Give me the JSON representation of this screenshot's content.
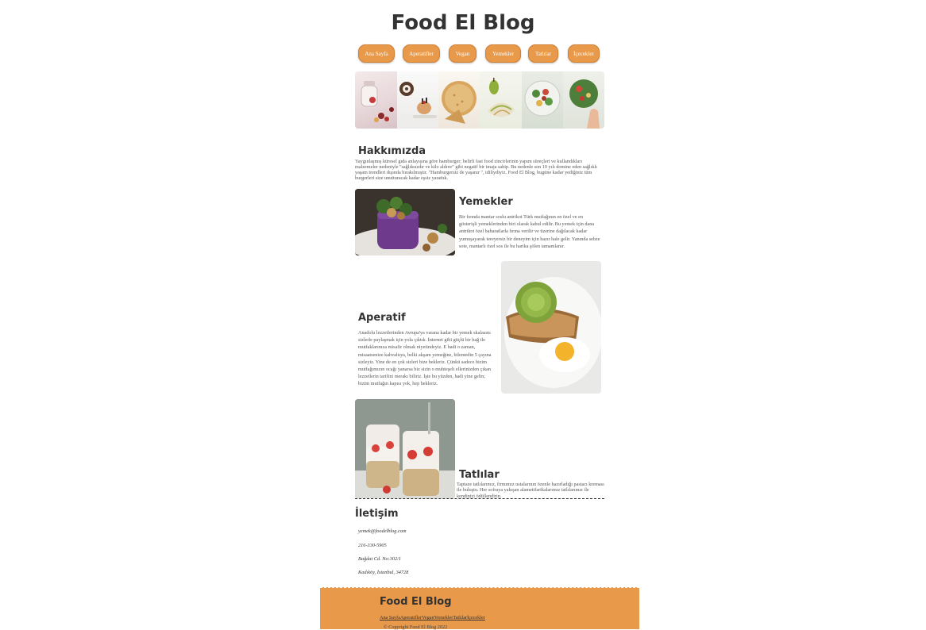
{
  "site": {
    "title": "Food El Blog"
  },
  "nav": {
    "items": [
      "Ana Sayfa",
      "Aperatifler",
      "Vegan",
      "Yemekler",
      "Tatlılar",
      "İçecekler"
    ]
  },
  "about": {
    "heading": "Hakkımızda",
    "text": "Yaygınlaşmış küresel gıda anlayışına göre hamburger; belirli fast food zincirlerinin yapım süreçleri ve kullandıkları malzemeler nedeniyle \"sağlıksızdır ve kilo aldırır\" gibi negatif bir imaja sahip. Bu nedenle son 10 yılı domine eden sağlıklı yaşam trendleri dışında bırakılmıştır. \"Hamburgersiz de yaşanır \", idiliydiyiz. Food El Blog, bugüne kadar yediğiniz tüm burgerleri size unutturacak kadar eşsiz yarattık."
  },
  "yemekler": {
    "heading": "Yemekler",
    "text": "Bir fırında mantar soslu antrikot Türk mutfağının en özel ve en gösterişli yemeklerinden biri olarak kabul edilir. Bu yemek için dana antrikot özel baharatlarla fırına verilir ve üzerine dağılacak kadar yumuşayarak tereyersiz bir deneyim için hazır hale gelir. Yanında sebze sote, mantarlı özel sos ile bu harika şölen tamamlanır."
  },
  "aperatif": {
    "heading": "Aperatif",
    "text": "Anadolu lezzetlerinden Avrupa'ya varana kadar bir yemek skalasını sizlerle paylaşmak için yola çıktık. İnternet gibi güçlü bir bağ ile mutfaklarınıza misafir olmak niyetindeyiz. E hadi o zaman, misaatsenize kahvaltıya, belki akşam yemeğine, bilemedin 5 çayına sizleyiz. Yine de en çok sizleri bize bekleriz. Çünkü sadece bizim mutfağımızın ocağı yanarsa biz sizin o muhteşelt ellerinizden çıkan lezzetlerin tarifini merakı biliriz. İşte bu yüzden, hadi yine gelin; bizim mutfağın kapısı yok, hep bekleriz."
  },
  "tatlilar": {
    "heading": "Tatlılar",
    "text": "Taptaze tatlılarımız, firmımız ustalarının özenle hazırladığı pastacı kreması ile buluştu. Her sofraya yakışan alametifarikalarımız tatlılarımız ile kendinizi ödüllendirin."
  },
  "contact": {
    "heading": "İletişim",
    "email": "yemek@foodelblog.com",
    "phone": "216-330-5905",
    "address1": "Bağdat Cd. No:302/1",
    "address2": "Kadıköy, İstanbul, 34728"
  },
  "footer": {
    "title": "Food El Blog",
    "links": [
      "Ana Sayfa",
      "Aperatifler",
      "Vegan",
      "Yemekler",
      "Tatlılar",
      "İçecekler"
    ],
    "copyright": "© Copyright Food El Blog 2022"
  },
  "colors": {
    "accent": "#e8994a",
    "text": "#333333"
  }
}
